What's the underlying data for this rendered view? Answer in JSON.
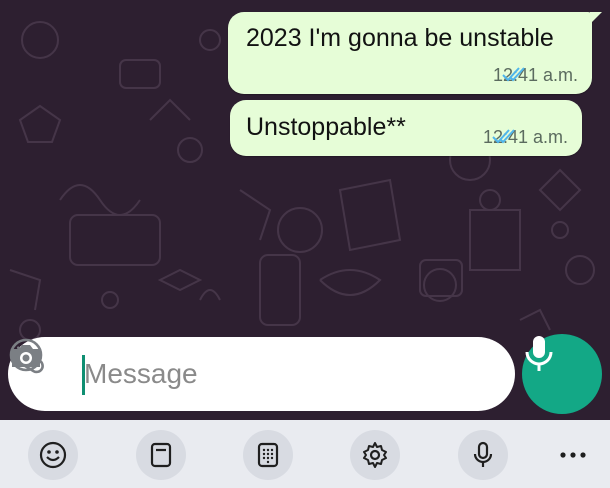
{
  "messages": [
    {
      "text": "2023 I'm gonna be unstable",
      "time": "12:41 a.m.",
      "status": "read"
    },
    {
      "text": "Unstoppable**",
      "time": "12:41 a.m.",
      "status": "read"
    }
  ],
  "composer": {
    "placeholder": "Message"
  },
  "colors": {
    "chat_background": "#2d1f30",
    "outgoing_bubble": "#e6fdd7",
    "read_ticks": "#4fb6ec",
    "mic_button": "#13a886",
    "keyboard_bar": "#e9ebf0"
  },
  "icons": {
    "composer": [
      "emoji-icon",
      "paperclip-icon",
      "camera-icon",
      "mic-icon"
    ],
    "keyboard_toolbar": [
      "emoji-icon",
      "clipboard-icon",
      "keypad-icon",
      "settings-gear-icon",
      "microphone-icon",
      "more-dots-icon"
    ]
  }
}
